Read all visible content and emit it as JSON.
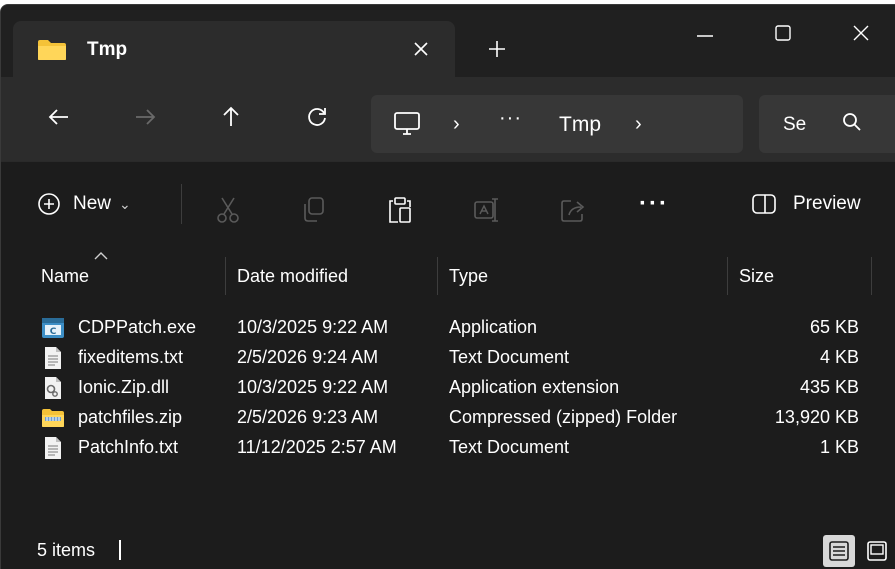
{
  "window": {
    "tab_title": "Tmp",
    "icons": {
      "tab": "folder-icon",
      "close_tab": "close-icon",
      "new_tab": "plus-icon"
    }
  },
  "nav": {
    "back": "arrow-left-icon",
    "forward": "arrow-right-icon",
    "up": "arrow-up-icon",
    "refresh": "refresh-icon"
  },
  "address": {
    "root_icon": "computer-icon",
    "ellipsis": "···",
    "crumb": "Tmp",
    "separator": "›"
  },
  "search": {
    "placeholder": "Se",
    "icon": "search-icon"
  },
  "commandbar": {
    "new_label": "New",
    "new_chevron": "⌄",
    "more": "···",
    "preview_label": "Preview"
  },
  "columns": {
    "name": "Name",
    "date": "Date modified",
    "type": "Type",
    "size": "Size"
  },
  "files": [
    {
      "icon": "application-icon",
      "name": "CDPPatch.exe",
      "date": "10/3/2025 9:22 AM",
      "type": "Application",
      "size": "65 KB"
    },
    {
      "icon": "text-file-icon",
      "name": "fixeditems.txt",
      "date": "2/5/2026 9:24 AM",
      "type": "Text Document",
      "size": "4 KB"
    },
    {
      "icon": "dll-file-icon",
      "name": "Ionic.Zip.dll",
      "date": "10/3/2025 9:22 AM",
      "type": "Application extension",
      "size": "435 KB"
    },
    {
      "icon": "zip-folder-icon",
      "name": "patchfiles.zip",
      "date": "2/5/2026 9:23 AM",
      "type": "Compressed (zipped) Folder",
      "size": "13,920 KB"
    },
    {
      "icon": "text-file-icon",
      "name": "PatchInfo.txt",
      "date": "11/12/2025 2:57 AM",
      "type": "Text Document",
      "size": "1 KB"
    }
  ],
  "status": {
    "count": "5 items"
  },
  "colors": {
    "background": "#1c1c1c",
    "toolbar": "#2c2c2c",
    "addressbar": "#373737",
    "folder": "#f4c238"
  }
}
